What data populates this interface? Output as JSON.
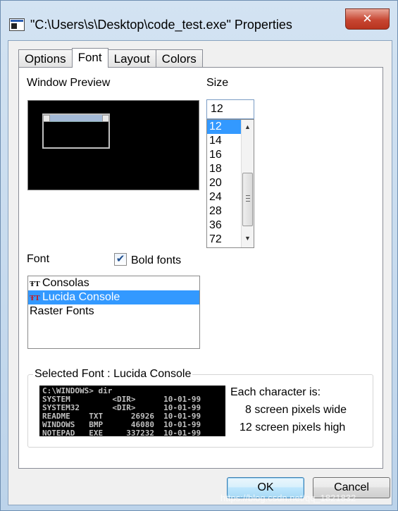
{
  "window": {
    "title": "\"C:\\Users\\s\\Desktop\\code_test.exe\" Properties",
    "close_glyph": "✕"
  },
  "tabs": [
    {
      "label": "Options",
      "active": false
    },
    {
      "label": "Font",
      "active": true
    },
    {
      "label": "Layout",
      "active": false
    },
    {
      "label": "Colors",
      "active": false
    }
  ],
  "preview": {
    "label": "Window Preview"
  },
  "size": {
    "label": "Size",
    "value": "12",
    "options": [
      "12",
      "14",
      "16",
      "18",
      "20",
      "24",
      "28",
      "36",
      "72"
    ],
    "selected": "12"
  },
  "font": {
    "label": "Font",
    "bold_label": "Bold fonts",
    "bold_checked": true,
    "check_glyph": "✔",
    "tt_glyph": "ŦT",
    "items": [
      {
        "label": "Consolas",
        "icon": "truetype-icon",
        "selected": false
      },
      {
        "label": "Lucida Console",
        "icon": "truetype-icon",
        "selected": true
      },
      {
        "label": "Raster Fonts",
        "icon": "",
        "selected": false
      }
    ]
  },
  "selected_font": {
    "title": "Selected Font : Lucida Console",
    "console_lines": [
      "C:\\WINDOWS> dir",
      "SYSTEM         <DIR>      10-01-99",
      "SYSTEM32       <DIR>      10-01-99",
      "README    TXT      26926  10-01-99",
      "WINDOWS   BMP      46080  10-01-99",
      "NOTEPAD   EXE     337232  10-01-99"
    ],
    "char_label": "Each character is:",
    "width_text": "8 screen pixels wide",
    "height_text": "12 screen pixels high"
  },
  "buttons": {
    "ok": "OK",
    "cancel": "Cancel"
  },
  "watermark": "https://blog.csdn.net/qq_1821832",
  "colors": {
    "selection": "#3399ff",
    "console_bg": "#000000"
  }
}
